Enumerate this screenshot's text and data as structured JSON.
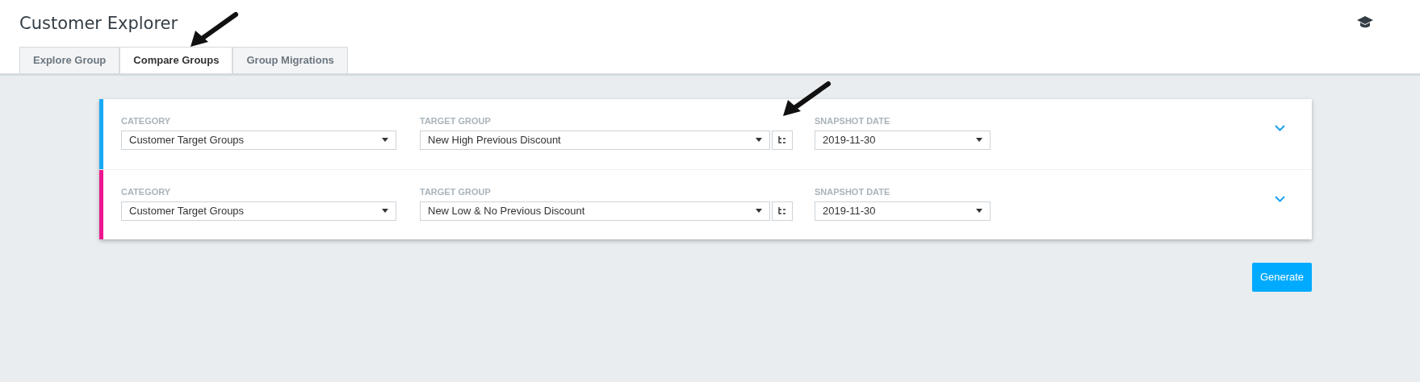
{
  "title": "Customer Explorer",
  "tabs": [
    {
      "label": "Explore Group",
      "selected": false
    },
    {
      "label": "Compare Groups",
      "selected": true
    },
    {
      "label": "Group Migrations",
      "selected": false
    }
  ],
  "groups": [
    {
      "color": "#19a9f5",
      "category_label": "CATEGORY",
      "category": "Customer Target Groups",
      "target_label": "TARGET GROUP",
      "target": "New High Previous Discount",
      "date_label": "SNAPSHOT DATE",
      "date": "2019-11-30"
    },
    {
      "color": "#ec168f",
      "category_label": "CATEGORY",
      "category": "Customer Target Groups",
      "target_label": "TARGET GROUP",
      "target": "New Low & No Previous Discount",
      "date_label": "SNAPSHOT DATE",
      "date": "2019-11-30"
    }
  ],
  "generate_button": "Generate"
}
